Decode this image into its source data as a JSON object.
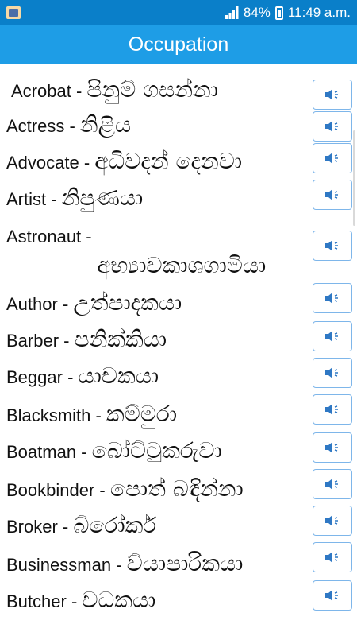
{
  "status": {
    "battery": "84%",
    "time": "11:49 a.m."
  },
  "header": {
    "title": "Occupation"
  },
  "items": [
    {
      "english": "Acrobat",
      "sep": " - ",
      "sinhala": "පිනුම් ගසන්නා"
    },
    {
      "english": "Actress",
      "sep": " - ",
      "sinhala": "නිළිය"
    },
    {
      "english": "Advocate",
      "sep": " - ",
      "sinhala": "අධිවදන් දෙනවා"
    },
    {
      "english": "Artist",
      "sep": " - ",
      "sinhala": "නිපුණයා"
    },
    {
      "english": "Astronaut",
      "sep": " - ",
      "sinhala": "අභ්‍යාවකාශගාමියා"
    },
    {
      "english": "Author",
      "sep": " - ",
      "sinhala": "උත්පාදකයා"
    },
    {
      "english": "Barber",
      "sep": " - ",
      "sinhala": "පනික්කියා"
    },
    {
      "english": "Beggar",
      "sep": " - ",
      "sinhala": "යාචකයා"
    },
    {
      "english": "Blacksmith",
      "sep": " - ",
      "sinhala": "කම්මුරා"
    },
    {
      "english": "Boatman",
      "sep": " - ",
      "sinhala": "බෝට්ටුකරුවා"
    },
    {
      "english": "Bookbinder",
      "sep": " - ",
      "sinhala": "පොත් බඳින්නා"
    },
    {
      "english": "Broker",
      "sep": " - ",
      "sinhala": "බ්රෝකර්"
    },
    {
      "english": "Businessman",
      "sep": " - ",
      "sinhala": "ව්යාපාරිකයා"
    },
    {
      "english": "Butcher",
      "sep": " - ",
      "sinhala": "වධකයා"
    }
  ]
}
